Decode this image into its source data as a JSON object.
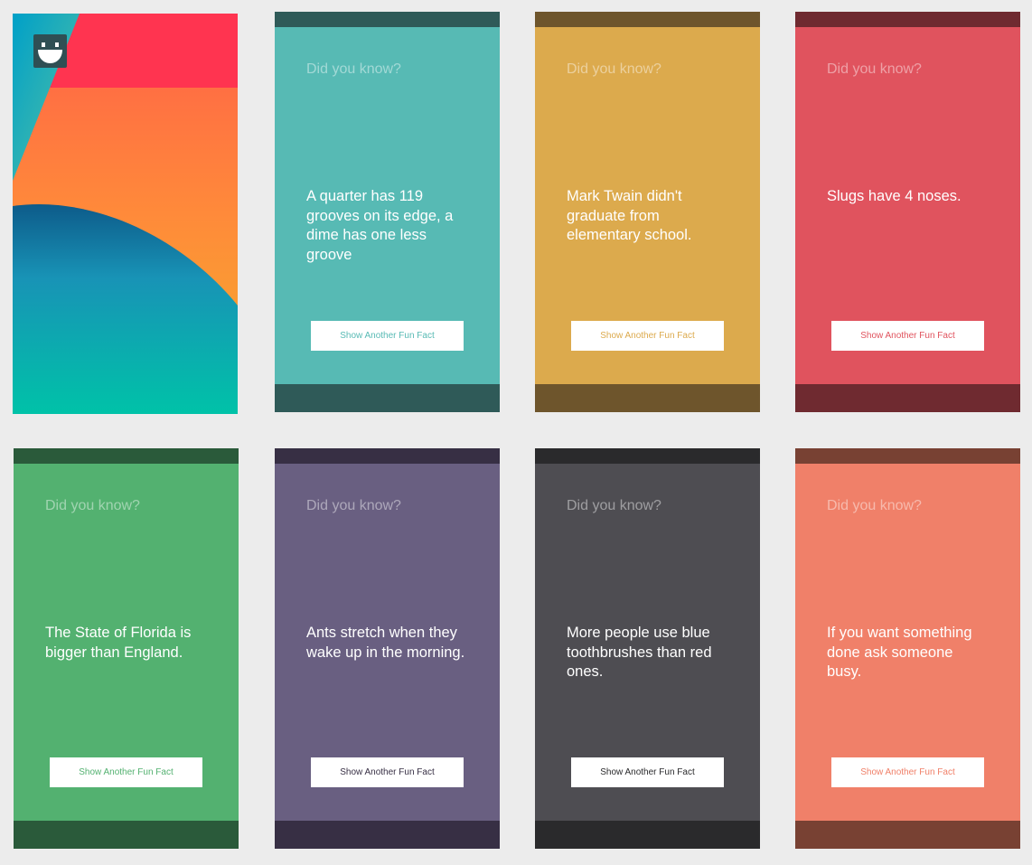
{
  "splash": {
    "logo_icon": "smiley-face-icon"
  },
  "label": "Did you know?",
  "button_label": "Show Another Fun Fact",
  "cards": [
    {
      "fact": "A quarter has 119 grooves on its edge, a dime has one less groove",
      "color": "#57bab4",
      "dark": "#2f5a58",
      "button_text_color": "#57bab4"
    },
    {
      "fact": "Mark Twain didn't graduate from elementary school.",
      "color": "#dcaa4d",
      "dark": "#6e552c",
      "button_text_color": "#dcaa4d"
    },
    {
      "fact": "Slugs have 4 noses.",
      "color": "#e0535e",
      "dark": "#6f2a30",
      "button_text_color": "#e0535e"
    },
    {
      "fact": "The State of Florida is bigger than England.",
      "color": "#53b170",
      "dark": "#2a5a3a",
      "button_text_color": "#53b170"
    },
    {
      "fact": "Ants stretch when they wake up in the morning.",
      "color": "#695f81",
      "dark": "#372f44",
      "button_text_color": "#372f44"
    },
    {
      "fact": "More people use blue toothbrushes than red ones.",
      "color": "#4e4d52",
      "dark": "#2a2a2c",
      "button_text_color": "#2a2a2c"
    },
    {
      "fact": "If you want something done ask someone busy.",
      "color": "#f08069",
      "dark": "#784133",
      "button_text_color": "#f08069"
    }
  ]
}
